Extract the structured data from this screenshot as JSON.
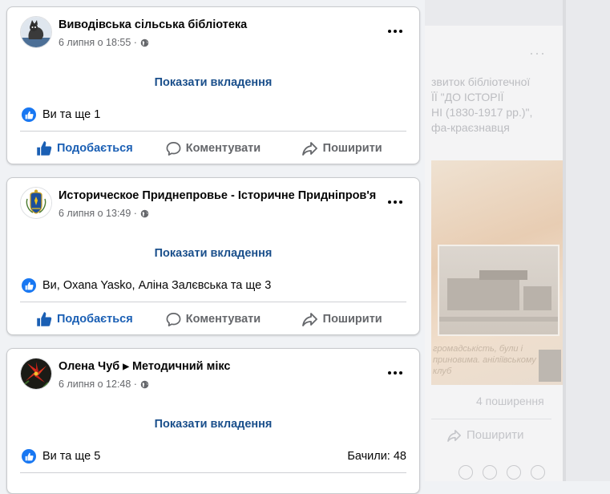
{
  "posts": [
    {
      "author": "Виводівська сільська бібліотека",
      "group": "",
      "timestamp": "6 липня о 18:55 ·",
      "attachment_label": "Показати вкладення",
      "reactions_text": "Ви та ще 1",
      "views": "",
      "like_label": "Подобається",
      "comment_label": "Коментувати",
      "share_label": "Поширити",
      "liked": true
    },
    {
      "author": "Историческое Приднепровье - Історичне Придніпров'я",
      "group": "",
      "timestamp": "6 липня о 13:49 ·",
      "attachment_label": "Показати вкладення",
      "reactions_text": "Ви, Oxana Yasko, Аліна Залєвська та ще 3",
      "views": "",
      "like_label": "Подобається",
      "comment_label": "Коментувати",
      "share_label": "Поширити",
      "liked": true
    },
    {
      "author": "Олена Чуб",
      "group": "Методичний мікс",
      "timestamp": "6 липня о 12:48 ·",
      "attachment_label": "Показати вкладення",
      "reactions_text": "Ви та ще 5",
      "views": "Бачили: 48",
      "liked": true
    }
  ],
  "background_post": {
    "text_lines": [
      "звиток бібліотечної",
      "ЇЇ \"ДО ІСТОРІЇ",
      "НІ (1830-1917 рр.)\",",
      "фа-краєзнавця"
    ],
    "image_caption": "громадськість, були і приновима. аніліївському клуб",
    "shares": "4 поширення",
    "share_label": "Поширити"
  },
  "colors": {
    "accent_blue": "#1877f2",
    "link_blue": "#1a4f8b",
    "muted_text": "#65676b",
    "card_border": "#c8cacd"
  },
  "icons": [
    "globe-icon",
    "more-icon",
    "like-icon",
    "comment-icon",
    "share-icon"
  ]
}
